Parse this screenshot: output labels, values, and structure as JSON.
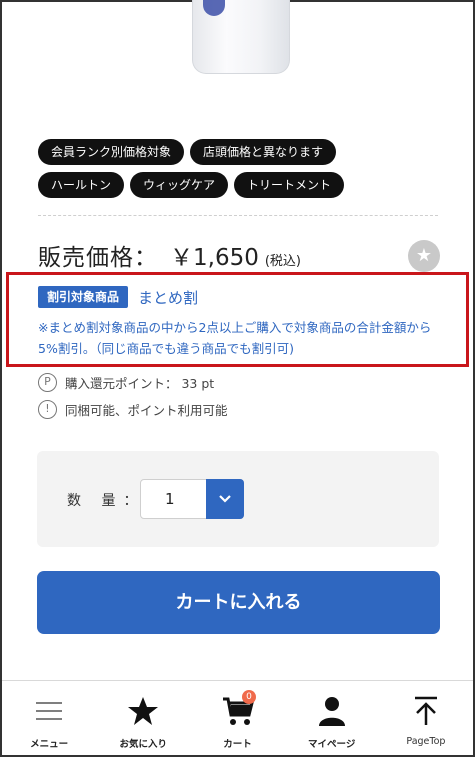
{
  "tags": {
    "row1": [
      "会員ランク別価格対象",
      "店頭価格と異なります"
    ],
    "row2": [
      "ハールトン",
      "ウィッグケア",
      "トリートメント"
    ]
  },
  "price": {
    "label": "販売価格：",
    "value": "￥1,650",
    "tax": "(税込)"
  },
  "discount": {
    "badge": "割引対象商品",
    "name": "まとめ割",
    "note": "※まとめ割対象商品の中から2点以上ご購入で対象商品の合計金額から5%割引。（同じ商品でも違う商品でも割引可)"
  },
  "info": {
    "points_icon": "P",
    "points_text": "購入還元ポイント： 33 pt",
    "notice_icon": "!",
    "notice_text": "同梱可能、ポイント利用可能"
  },
  "quantity": {
    "label": "数 量：",
    "value": "1"
  },
  "cart_button": "カートに入れる",
  "nav": {
    "menu": "メニュー",
    "favorites": "お気に入り",
    "cart": "カート",
    "cart_count": "0",
    "mypage": "マイページ",
    "pagetop": "PageTop"
  },
  "colors": {
    "accent": "#2f67c0",
    "highlight_border": "#c9161b",
    "tag_bg": "#111111",
    "badge_count": "#f06a4b"
  }
}
